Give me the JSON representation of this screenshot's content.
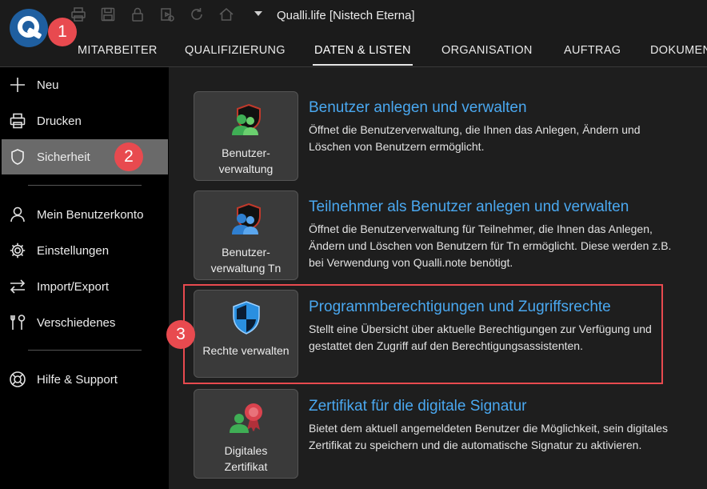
{
  "titlebar": {
    "title": "Qualli.life [Nistech Eterna]",
    "quick_access_icons": [
      "printer-icon",
      "save-icon",
      "lock-icon",
      "video-icon",
      "refresh-icon",
      "home-icon"
    ]
  },
  "menu": {
    "items": [
      {
        "label": "MITARBEITER"
      },
      {
        "label": "QUALIFIZIERUNG"
      },
      {
        "label": "DATEN & LISTEN",
        "active": true
      },
      {
        "label": "ORGANISATION"
      },
      {
        "label": "AUFTRAG"
      },
      {
        "label": "DOKUMEN"
      }
    ]
  },
  "sidebar": {
    "items": [
      {
        "label": "Neu",
        "icon": "plus-icon"
      },
      {
        "label": "Drucken",
        "icon": "printer-icon"
      },
      {
        "label": "Sicherheit",
        "icon": "shield-icon",
        "active": true
      },
      {
        "label": "Mein Benutzerkonto",
        "icon": "user-icon"
      },
      {
        "label": "Einstellungen",
        "icon": "gear-icon"
      },
      {
        "label": "Import/Export",
        "icon": "arrows-icon"
      },
      {
        "label": "Verschiedenes",
        "icon": "tools-icon"
      },
      {
        "label": "Hilfe & Support",
        "icon": "lifebuoy-icon"
      }
    ]
  },
  "cards": [
    {
      "tile_line1": "Benutzer-",
      "tile_line2": "verwaltung",
      "title": "Benutzer anlegen und verwalten",
      "description": "Öffnet die Benutzerverwaltung, die Ihnen das Anlegen, Ändern und Löschen von Benutzern ermöglicht."
    },
    {
      "tile_line1": "Benutzer-",
      "tile_line2": "verwaltung Tn",
      "title": "Teilnehmer als Benutzer anlegen und verwalten",
      "description": "Öffnet die Benutzerverwaltung für Teilnehmer, die Ihnen das Anlegen, Ändern und Löschen von Benutzern für Tn ermöglicht. Diese werden z.B. bei Verwendung von Qualli.note benötigt."
    },
    {
      "tile_line1": "Rechte verwalten",
      "tile_line2": "",
      "title": "Programmberechtigungen und Zugriffsrechte",
      "description": "Stellt eine Übersicht über aktuelle Berechtigungen zur Verfügung und gestattet den Zugriff auf den Berechtigungsassistenten."
    },
    {
      "tile_line1": "Digitales",
      "tile_line2": "Zertifikat",
      "title": "Zertifikat für die digitale Signatur",
      "description": "Bietet dem aktuell angemeldeten Benutzer die Möglichkeit, sein digitales Zertifikat zu speichern und die automatische Signatur zu aktivieren."
    }
  ],
  "callouts": [
    "1",
    "2",
    "3"
  ],
  "colors": {
    "accent_link": "#4aa8f0",
    "callout_red": "#e84a4f",
    "logo_blue": "#1f5fa0",
    "sidebar_active": "#6a6a6a"
  }
}
